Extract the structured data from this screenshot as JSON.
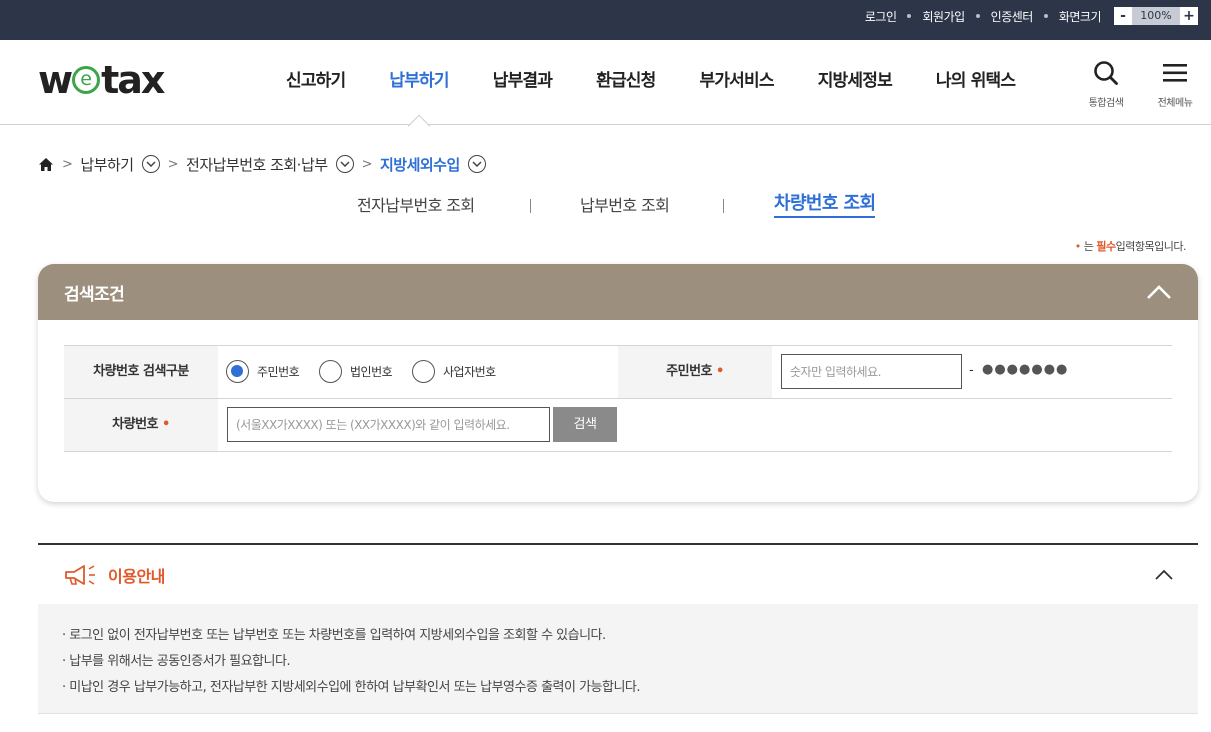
{
  "topbar": {
    "links": [
      "로그인",
      "회원가입",
      "인증센터",
      "화면크기"
    ],
    "zoom_minus": "-",
    "zoom_value": "100%",
    "zoom_plus": "+"
  },
  "header": {
    "logo_w": "w",
    "logo_e": "e",
    "logo_tax": "tax",
    "nav": [
      "신고하기",
      "납부하기",
      "납부결과",
      "환급신청",
      "부가서비스",
      "지방세정보",
      "나의 위택스"
    ],
    "active_nav_index": 1,
    "search_label": "통합검색",
    "menu_label": "전체메뉴"
  },
  "breadcrumb": {
    "items": [
      "납부하기",
      "전자납부번호 조회·납부",
      "지방세외수입"
    ]
  },
  "subtabs": [
    "전자납부번호 조회",
    "납부번호 조회",
    "차량번호 조회"
  ],
  "required_note": {
    "dot": "•",
    "pre": "는",
    "strong": "필수",
    "post": "입력항목입니다."
  },
  "search_panel": {
    "title": "검색조건",
    "type_label": "차량번호 검색구분",
    "radio_options": [
      "주민번호",
      "법인번호",
      "사업자번호"
    ],
    "selected_radio_index": 0,
    "id_label": "주민번호",
    "required_mark": "•",
    "id_placeholder": "숫자만 입력하세요.",
    "id_dash": "-",
    "id_masked": "●●●●●●●",
    "car_label": "차량번호",
    "car_placeholder": "(서울XX가XXXX) 또는 (XX가XXXX)와 같이 입력하세요.",
    "search_button": "검색"
  },
  "usage_info": {
    "title": "이용안내",
    "items": [
      "· 로그인 없이 전자납부번호 또는 납부번호 또는 차량번호를 입력하여 지방세외수입을 조회할 수 있습니다.",
      "· 납부를 위해서는 공동인증서가 필요합니다.",
      "· 미납인 경우 납부가능하고, 전자납부한 지방세외수입에 한하여 납부확인서 또는 납부영수증 출력이 가능합니다."
    ]
  },
  "colors": {
    "topbar_bg": "#2d3548",
    "accent_blue": "#2f6fd6",
    "panel_header": "#9c8f7d",
    "required_orange": "#e0592a",
    "logo_green": "#3aa54a"
  }
}
